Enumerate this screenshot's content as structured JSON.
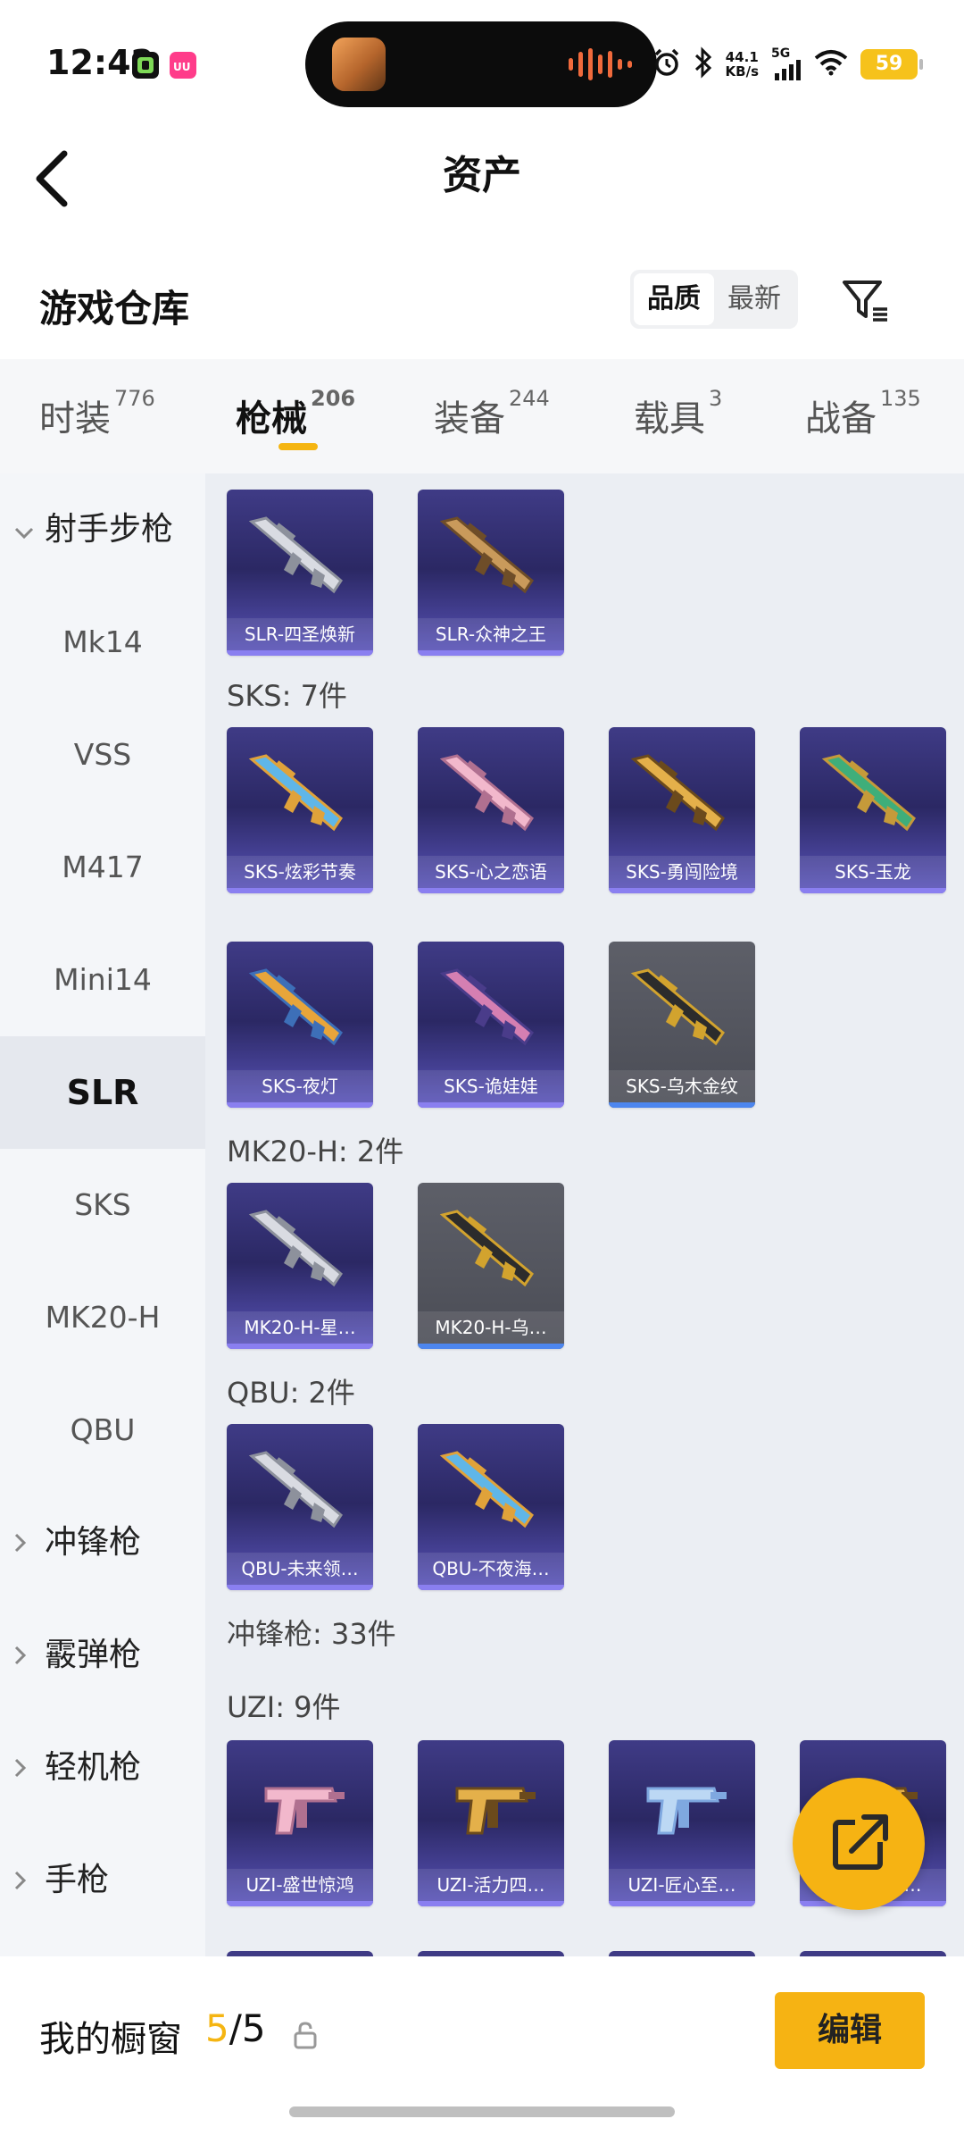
{
  "status_bar": {
    "time": "12:42",
    "net_speed_value": "44.1",
    "net_speed_unit": "KB/s",
    "network": "5G",
    "battery": "59"
  },
  "header": {
    "title": "资产",
    "section_title": "游戏仓库",
    "sort_options": [
      "品质",
      "最新"
    ],
    "active_sort": "品质"
  },
  "tabs": [
    {
      "label": "时装",
      "count": "776"
    },
    {
      "label": "枪械",
      "count": "206"
    },
    {
      "label": "装备",
      "count": "244"
    },
    {
      "label": "载具",
      "count": "3"
    },
    {
      "label": "战备",
      "count": "135"
    }
  ],
  "active_tab": "枪械",
  "sidebar": {
    "groups": [
      "射手步枪",
      "冲锋枪",
      "霰弹枪",
      "轻机枪",
      "手枪"
    ],
    "sub_items": [
      "Mk14",
      "VSS",
      "M417",
      "Mini14",
      "SLR",
      "SKS",
      "MK20-H",
      "QBU"
    ],
    "active_item": "SLR"
  },
  "content": {
    "slr_items": [
      {
        "label": "SLR-四圣焕新",
        "tone": "silver"
      },
      {
        "label": "SLR-众神之王",
        "tone": "bronze"
      }
    ],
    "sks_header": "SKS: 7件",
    "sks_items": [
      {
        "label": "SKS-炫彩节奏",
        "tone": "rainbow"
      },
      {
        "label": "SKS-心之恋语",
        "tone": "pink"
      },
      {
        "label": "SKS-勇闯险境",
        "tone": "gold"
      },
      {
        "label": "SKS-玉龙",
        "tone": "jade"
      },
      {
        "label": "SKS-夜灯",
        "tone": "amber"
      },
      {
        "label": "SKS-诡娃娃",
        "tone": "rose"
      },
      {
        "label": "SKS-乌木金纹",
        "tone": "ebony"
      }
    ],
    "mk20_header": "MK20-H: 2件",
    "mk20_items": [
      {
        "label": "MK20-H-星…",
        "tone": "silver"
      },
      {
        "label": "MK20-H-乌…",
        "tone": "ebony"
      }
    ],
    "qbu_header": "QBU: 2件",
    "qbu_items": [
      {
        "label": "QBU-未来领…",
        "tone": "silver"
      },
      {
        "label": "QBU-不夜海…",
        "tone": "rainbow"
      }
    ],
    "smg_header": "冲锋枪: 33件",
    "uzi_header": "UZI: 9件",
    "uzi_items": [
      {
        "label": "UZI-盛世惊鸿",
        "tone": "pink"
      },
      {
        "label": "UZI-活力四…",
        "tone": "gold"
      },
      {
        "label": "UZI-匠心至…",
        "tone": "ice"
      },
      {
        "label": "UZI-…音(…",
        "tone": "gold"
      }
    ]
  },
  "bottom_bar": {
    "showcase_label": "我的橱窗",
    "showcase_current": "5",
    "showcase_total": "/5",
    "edit_label": "编辑"
  },
  "colors": {
    "accent": "#f6b313",
    "card_purple": "#3f3b86",
    "card_gold_bg": "#52545d"
  }
}
